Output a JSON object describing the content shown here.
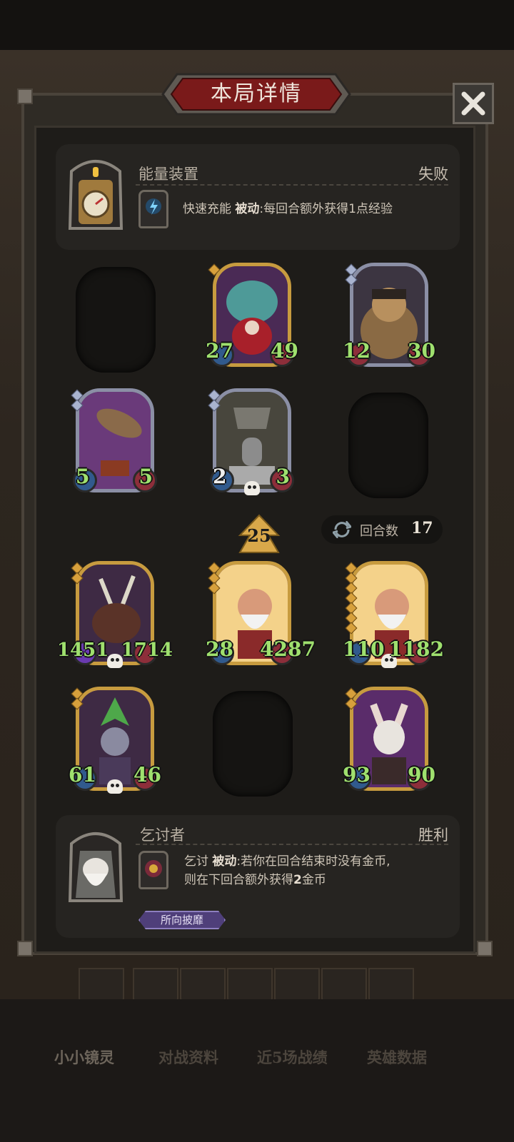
{
  "dialog": {
    "title": "本局详情",
    "close_icon": "close-icon"
  },
  "top_player": {
    "name": "能量装置",
    "result": "失败",
    "ability_name": "快速充能",
    "ability_type": "被动",
    "ability_desc": ":每回合额外获得1点经验"
  },
  "top_board": [
    {
      "atk": "27",
      "hp": "49"
    },
    {
      "atk": "12",
      "hp": "30"
    },
    {
      "atk": "5",
      "hp": "5"
    },
    {
      "atk": "2",
      "hp": "3"
    }
  ],
  "level": "25",
  "turns": {
    "label": "回合数",
    "value": "17"
  },
  "bottom_board": [
    {
      "atk": "1451",
      "hp": "1714"
    },
    {
      "atk": "28",
      "hp": "4287"
    },
    {
      "atk": "110",
      "hp": "1182"
    },
    {
      "atk": "61",
      "hp": "46"
    },
    {
      "atk": "93",
      "hp": "90"
    }
  ],
  "bottom_player": {
    "name": "乞讨者",
    "result": "胜利",
    "ability_name": "乞讨",
    "ability_type": "被动",
    "ability_desc_1": ":若你在回合结束时没有金币,",
    "ability_desc_2": "则在下回合额外获得",
    "ability_desc_num": "2",
    "ability_desc_3": "金币",
    "badge": "所向披靡"
  },
  "bottom_tabs": [
    "小小镜灵",
    "对战资料",
    "近5场战绩",
    "英雄数据"
  ],
  "colors": {
    "stat_green": "#9fe06e",
    "gold_frame": "#c79b3f",
    "dialog_red": "#7a1a1a"
  }
}
